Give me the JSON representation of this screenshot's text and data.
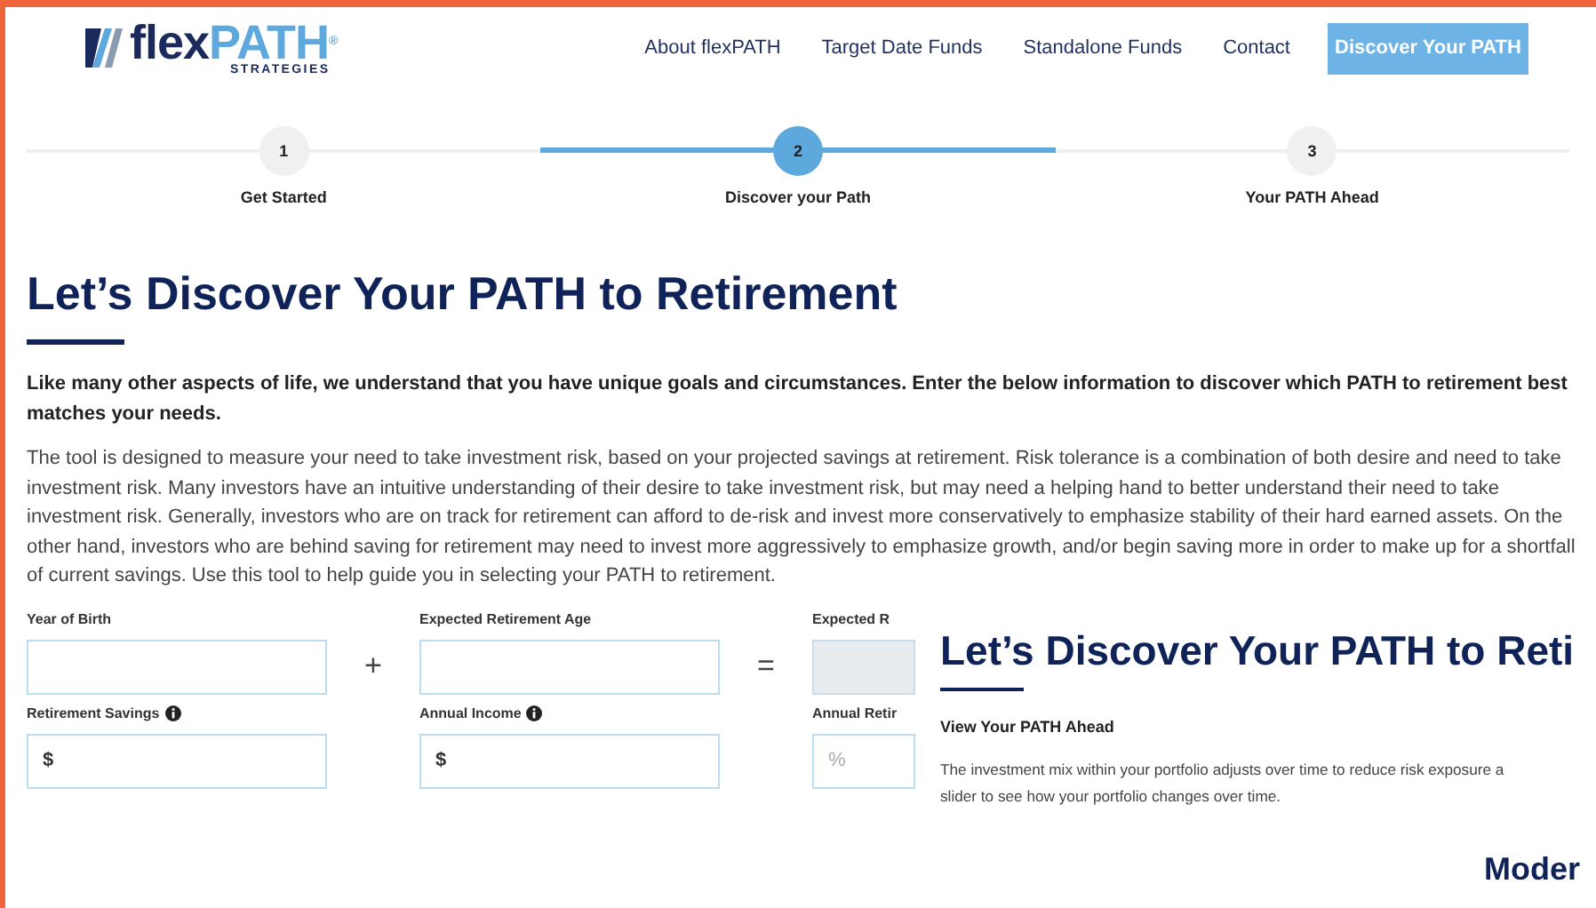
{
  "header": {
    "logo": {
      "parts": [
        "flex",
        "PATH"
      ],
      "mark": "®",
      "tagline": "STRATEGIES"
    },
    "nav": [
      {
        "label": "About flexPATH"
      },
      {
        "label": "Target Date Funds"
      },
      {
        "label": "Standalone Funds"
      },
      {
        "label": "Contact"
      }
    ],
    "cta": "Discover Your PATH"
  },
  "steps": [
    {
      "number": "1",
      "label": "Get Started",
      "selected": false
    },
    {
      "number": "2",
      "label": "Discover your Path",
      "selected": true
    },
    {
      "number": "3",
      "label": "Your PATH Ahead",
      "selected": false
    }
  ],
  "title": "Let’s Discover Your PATH to Retirement",
  "intro": "Like many other aspects of life, we understand that you have unique goals and circumstances. Enter the below information to discover which PATH to retirement best matches your needs.",
  "body": "The tool is designed to measure your need to take investment risk, based on your projected savings at retirement. Risk tolerance is a combination of both desire and need to take investment risk. Many investors have an intuitive understanding of their desire to take investment risk, but may need a helping hand to better understand their need to take investment risk. Generally, investors who are on track for retirement can afford to de-risk and invest more conservatively to emphasize stability of their hard earned assets. On the other hand, investors who are behind saving for retirement may need to invest more aggressively to emphasize growth, and/or begin saving more in order to make up for a shortfall of current savings. Use this tool to help guide you in selecting your PATH to retirement.",
  "form_rows": [
    {
      "items": [
        {
          "kind": "field",
          "label": "Year of Birth",
          "info": false,
          "disabled": false
        },
        {
          "kind": "operator",
          "symbol": "+"
        },
        {
          "kind": "field",
          "label": "Expected Retirement Age",
          "info": false,
          "disabled": false
        },
        {
          "kind": "operator",
          "symbol": "="
        },
        {
          "kind": "field",
          "label": "Expected R",
          "info": false,
          "disabled": true
        }
      ]
    },
    {
      "items": [
        {
          "kind": "field",
          "label": "Retirement Savings",
          "info": true,
          "disabled": false,
          "value": "$"
        },
        {
          "kind": "spacer"
        },
        {
          "kind": "field",
          "label": "Annual Income",
          "info": true,
          "disabled": false,
          "value": "$"
        },
        {
          "kind": "spacer"
        },
        {
          "kind": "field",
          "label": "Annual Retir",
          "info": false,
          "disabled": false,
          "placeholder": "%"
        }
      ]
    }
  ],
  "overlay": {
    "title": "Let’s Discover Your PATH to Reti",
    "subtitle": "View Your PATH Ahead",
    "text_lines": [
      "The investment mix within your portfolio adjusts over time to reduce risk exposure a",
      "slider to see how your portfolio changes over time."
    ],
    "heading": "Moder"
  }
}
